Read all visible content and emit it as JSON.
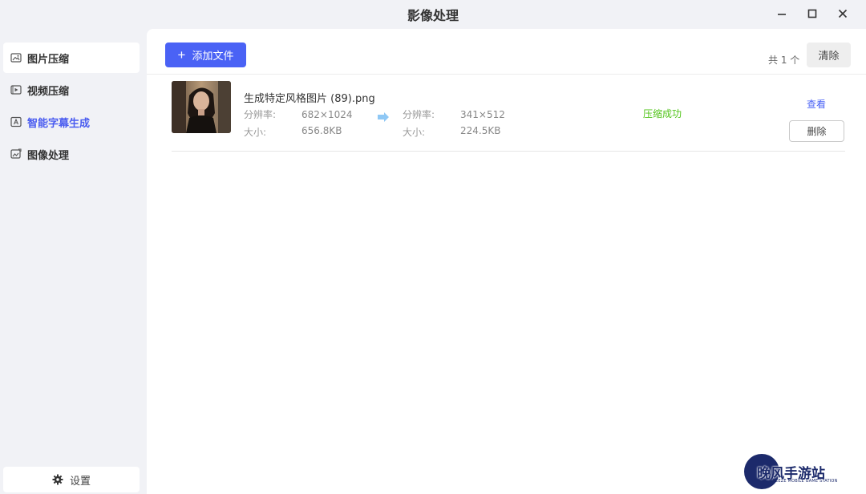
{
  "window": {
    "title": "影像处理"
  },
  "sidebar": {
    "items": [
      {
        "label": "图片压缩",
        "icon": "image-compress-icon"
      },
      {
        "label": "视频压缩",
        "icon": "video-icon"
      },
      {
        "label": "智能字幕生成",
        "icon": "subtitle-icon"
      },
      {
        "label": "图像处理",
        "icon": "image-edit-icon"
      }
    ],
    "settings_label": "设置"
  },
  "toolbar": {
    "add_label": "添加文件",
    "count": "共 1 个",
    "clear_label": "清除"
  },
  "files": [
    {
      "name": "生成特定风格图片 (89).png",
      "resolution_label": "分辨率:",
      "size_label": "大小:",
      "original_resolution": "682×1024",
      "original_size": "656.8KB",
      "compressed_resolution": "341×512",
      "compressed_size": "224.5KB",
      "status": "压缩成功",
      "view_label": "查看",
      "delete_label": "删除"
    }
  ],
  "watermark": {
    "title": "晚风手游站",
    "subtitle": "EVENING BREEZE MOBILE GAME STATION"
  },
  "colors": {
    "accent": "#4a62f5",
    "success": "#52c41a",
    "active_nav": "#4a5cf0",
    "background": "#f1f2f6"
  }
}
